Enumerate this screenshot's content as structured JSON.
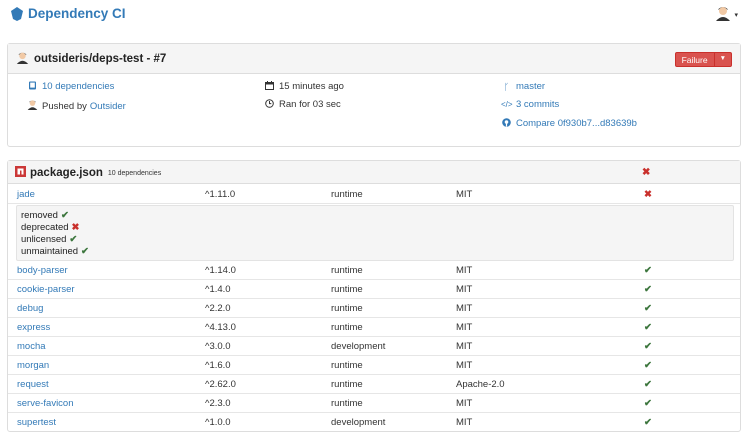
{
  "brand": {
    "title": "Dependency CI",
    "logo_icon": "shield-icon",
    "color": "#337ab7"
  },
  "user_menu": {
    "avatar_icon": "user-avatar-icon",
    "caret": "▾"
  },
  "build": {
    "repo": "outsideris/deps-test - #7",
    "status_button": "Failure",
    "status_color": "#d9534f",
    "dependencies_link": "10 dependencies",
    "pushed_by_prefix": "Pushed by",
    "pushed_by_user": "Outsider",
    "time_ago": "15 minutes ago",
    "duration": "Ran for 03 sec",
    "branch": "master",
    "commits": "3 commits",
    "compare": "Compare 0f930b7...d83639b"
  },
  "package": {
    "name": "package.json",
    "count": "10 dependencies",
    "status_mark": "✖",
    "details": [
      {
        "label": "removed",
        "mark": "✔"
      },
      {
        "label": "deprecated",
        "mark": "✖"
      },
      {
        "label": "unlicensed",
        "mark": "✔"
      },
      {
        "label": "unmaintained",
        "mark": "✔"
      }
    ],
    "rows": [
      {
        "name": "jade",
        "version": "^1.11.0",
        "scope": "runtime",
        "license": "MIT",
        "status": "✖"
      },
      {
        "name": "body-parser",
        "version": "^1.14.0",
        "scope": "runtime",
        "license": "MIT",
        "status": "✔"
      },
      {
        "name": "cookie-parser",
        "version": "^1.4.0",
        "scope": "runtime",
        "license": "MIT",
        "status": "✔"
      },
      {
        "name": "debug",
        "version": "^2.2.0",
        "scope": "runtime",
        "license": "MIT",
        "status": "✔"
      },
      {
        "name": "express",
        "version": "^4.13.0",
        "scope": "runtime",
        "license": "MIT",
        "status": "✔"
      },
      {
        "name": "mocha",
        "version": "^3.0.0",
        "scope": "development",
        "license": "MIT",
        "status": "✔"
      },
      {
        "name": "morgan",
        "version": "^1.6.0",
        "scope": "runtime",
        "license": "MIT",
        "status": "✔"
      },
      {
        "name": "request",
        "version": "^2.62.0",
        "scope": "runtime",
        "license": "Apache-2.0",
        "status": "✔"
      },
      {
        "name": "serve-favicon",
        "version": "^2.3.0",
        "scope": "runtime",
        "license": "MIT",
        "status": "✔"
      },
      {
        "name": "supertest",
        "version": "^1.0.0",
        "scope": "development",
        "license": "MIT",
        "status": "✔"
      }
    ]
  }
}
